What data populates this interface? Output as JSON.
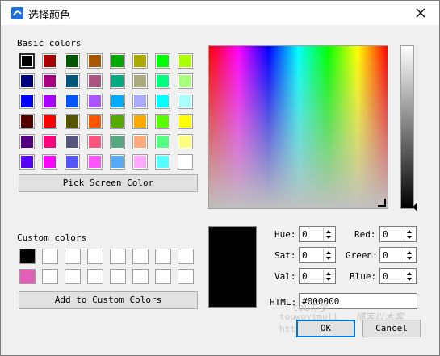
{
  "window": {
    "title": "选择颜色"
  },
  "basic": {
    "label": "Basic colors",
    "colors": [
      "#000000",
      "#aa0000",
      "#005500",
      "#aa5500",
      "#00aa00",
      "#aaaa00",
      "#00ff00",
      "#aaff00",
      "#00007f",
      "#aa007f",
      "#00557f",
      "#aa557f",
      "#00aa7f",
      "#aaaa7f",
      "#00ff7f",
      "#aaff7f",
      "#0000ff",
      "#aa00ff",
      "#0055ff",
      "#aa55ff",
      "#00aaff",
      "#aaaaff",
      "#00ffff",
      "#aaffff",
      "#550000",
      "#ff0000",
      "#555500",
      "#ff5500",
      "#55aa00",
      "#ffaa00",
      "#55ff00",
      "#ffff00",
      "#55007f",
      "#ff007f",
      "#55557f",
      "#ff557f",
      "#55aa7f",
      "#ffaa7f",
      "#55ff7f",
      "#ffff7f",
      "#5500ff",
      "#ff00ff",
      "#5555ff",
      "#ff55ff",
      "#55aaff",
      "#ffaaff",
      "#55ffff",
      "#ffffff"
    ]
  },
  "pick_label": "Pick Screen Color",
  "custom": {
    "label": "Custom colors",
    "colors": [
      "#000000",
      "#ffffff",
      "#ffffff",
      "#ffffff",
      "#ffffff",
      "#ffffff",
      "#ffffff",
      "#ffffff",
      "#e060b8",
      "#ffffff",
      "#ffffff",
      "#ffffff",
      "#ffffff",
      "#ffffff",
      "#ffffff",
      "#ffffff"
    ]
  },
  "add_label": "Add to Custom Colors",
  "fields": {
    "hue_label": "Hue:",
    "hue": "0",
    "sat_label": "Sat:",
    "sat": "0",
    "val_label": "Val:",
    "val": "0",
    "red_label": "Red:",
    "red": "0",
    "green_label": "Green:",
    "green": "0",
    "blue_label": "Blue:",
    "blue": "0",
    "html_label": "HTML:",
    "html": "#000000"
  },
  "buttons": {
    "ok": "OK",
    "cancel": "Cancel"
  },
  "watermark": {
    "line1": "tou亦梦",
    "line2": "touwoyimuli",
    "line3": "博客以木客",
    "line4": "http"
  },
  "current_color": "#000000"
}
